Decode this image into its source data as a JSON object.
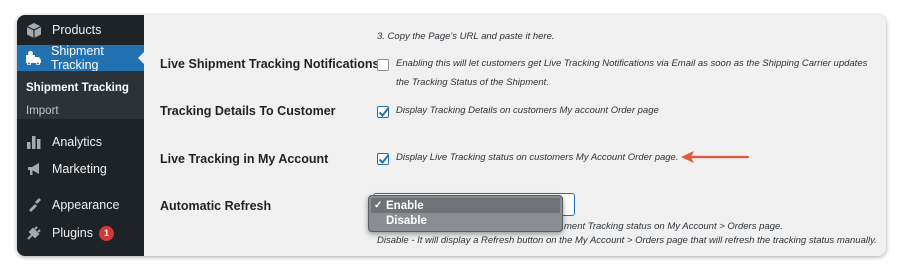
{
  "sidebar": {
    "items": [
      {
        "label": "Products",
        "icon": "products-icon"
      },
      {
        "label": "Shipment Tracking",
        "icon": "shipment-icon",
        "active": true
      },
      {
        "label": "Analytics",
        "icon": "analytics-icon"
      },
      {
        "label": "Marketing",
        "icon": "marketing-icon"
      },
      {
        "label": "Appearance",
        "icon": "appearance-icon"
      },
      {
        "label": "Plugins",
        "icon": "plugins-icon",
        "badge": "1"
      }
    ],
    "submenu": [
      {
        "label": "Shipment Tracking",
        "current": true
      },
      {
        "label": "Import"
      }
    ]
  },
  "settings": {
    "step_text": "3. Copy the Page's URL and paste it here.",
    "rows": [
      {
        "label": "Live Shipment Tracking Notifications",
        "checked": false,
        "desc_line1": "Enabling this will let customers get Live Tracking Notifications via Email as soon as the Shipping Carrier updates",
        "desc_line2": "the Tracking Status of the Shipment."
      },
      {
        "label": "Tracking Details To Customer",
        "checked": true,
        "desc_line1": "Display Tracking Details on customers My account Order page"
      },
      {
        "label": "Live Tracking in My Account",
        "checked": true,
        "desc_line1": "Display Live Tracking status on customers My Account Order page."
      },
      {
        "label": "Automatic Refresh"
      }
    ],
    "refresh_desc_line1": "ment Tracking status on My Account > Orders page.",
    "refresh_desc_line2": "Disable - It will display a Refresh button on the My Account > Orders page that will refresh the tracking status manually."
  },
  "dropdown": {
    "options": [
      {
        "label": "Enable",
        "selected": true
      },
      {
        "label": "Disable",
        "selected": false
      }
    ]
  },
  "colors": {
    "accent": "#2271b1",
    "arrow": "#e05a3a",
    "sidebar_bg": "#1d2327",
    "badge": "#d63638"
  }
}
